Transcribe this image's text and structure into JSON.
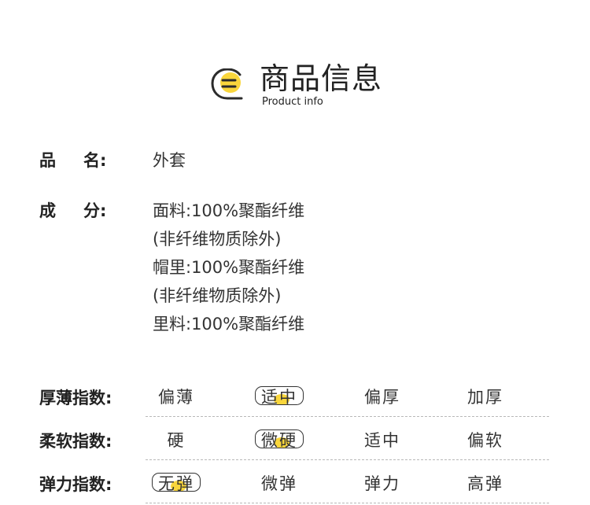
{
  "header": {
    "title": "商品信息",
    "subtitle": "Product info",
    "icon": "document-lines-icon",
    "accent_color": "#f9d63c"
  },
  "product": {
    "name_label_1": "品",
    "name_label_2": "名:",
    "name_value": "外套",
    "composition_label_1": "成",
    "composition_label_2": "分:",
    "composition_lines": [
      "面料:100%聚酯纤维",
      "(非纤维物质除外)",
      "帽里:100%聚酯纤维",
      "(非纤维物质除外)",
      "里料:100%聚酯纤维"
    ]
  },
  "indices": [
    {
      "label": "厚薄指数:",
      "options": [
        "偏薄",
        "适中",
        "偏厚",
        "加厚"
      ],
      "selected": "适中"
    },
    {
      "label": "柔软指数:",
      "options": [
        "硬",
        "微硬",
        "适中",
        "偏软"
      ],
      "selected": "微硬"
    },
    {
      "label": "弹力指数:",
      "options": [
        "无弹",
        "微弹",
        "弹力",
        "高弹"
      ],
      "selected": "无弹"
    }
  ]
}
